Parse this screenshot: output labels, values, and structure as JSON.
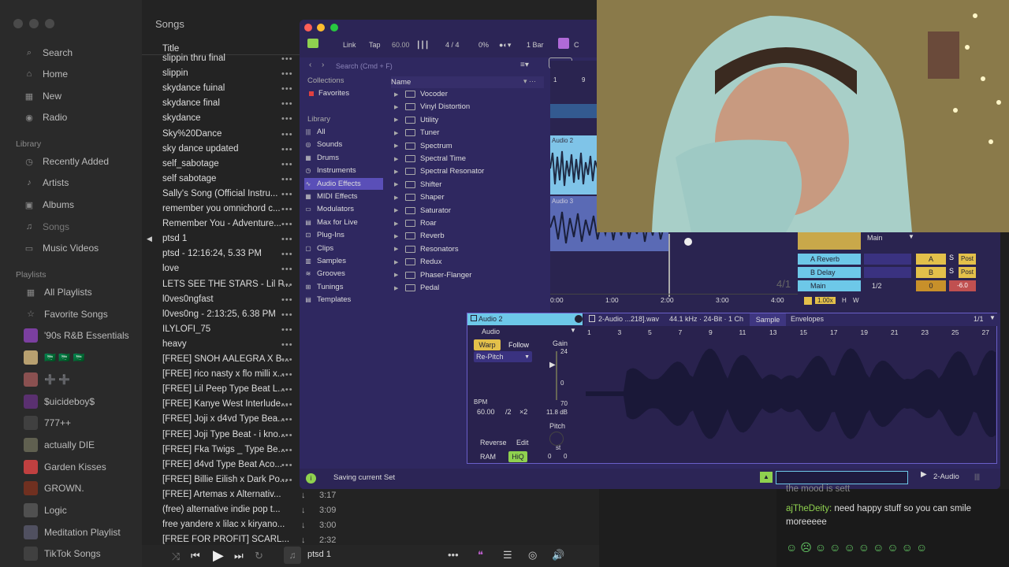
{
  "music": {
    "header_title": "Songs",
    "sidebar": {
      "items": [
        {
          "label": "Search",
          "icon": "search-icon"
        },
        {
          "label": "Home",
          "icon": "home-icon"
        },
        {
          "label": "New",
          "icon": "grid-icon"
        },
        {
          "label": "Radio",
          "icon": "radio-icon"
        }
      ],
      "library_header": "Library",
      "library": [
        {
          "label": "Recently Added",
          "icon": "clock-icon"
        },
        {
          "label": "Artists",
          "icon": "mic-icon"
        },
        {
          "label": "Albums",
          "icon": "album-icon"
        },
        {
          "label": "Songs",
          "icon": "music-note-icon"
        },
        {
          "label": "Music Videos",
          "icon": "tv-icon"
        }
      ],
      "playlists_header": "Playlists",
      "playlists": [
        {
          "label": "All Playlists",
          "icon": "grid-icon"
        },
        {
          "label": "Favorite Songs",
          "icon": "star-icon"
        },
        {
          "label": "'90s R&B Essentials",
          "color": "#7b3fa0"
        },
        {
          "label": "🇸🇦 🇸🇦 🇸🇦",
          "color": "#b8a070"
        },
        {
          "label": "➕ ➕",
          "color": "#8a5050"
        },
        {
          "label": "$uicideboy$",
          "color": "#5a3070"
        },
        {
          "label": "777++",
          "color": "#404040"
        },
        {
          "label": "actually DIE",
          "color": "#606050"
        },
        {
          "label": "Garden Kisses",
          "color": "#c04040"
        },
        {
          "label": "GROWN.",
          "color": "#703020"
        },
        {
          "label": "Logic",
          "color": "#505050"
        },
        {
          "label": "Meditation Playlist",
          "color": "#505060"
        },
        {
          "label": "TikTok Songs",
          "color": "#404040"
        }
      ]
    },
    "column_title": "Title",
    "songs": [
      {
        "title": "slippin thru final"
      },
      {
        "title": "slippin"
      },
      {
        "title": "skydance fuinal"
      },
      {
        "title": "skydance final"
      },
      {
        "title": "skydance"
      },
      {
        "title": "Sky%20Dance"
      },
      {
        "title": "sky dance updated"
      },
      {
        "title": "self_sabotage"
      },
      {
        "title": "self sabotage"
      },
      {
        "title": "Sally's Song (Official Instru..."
      },
      {
        "title": "remember you omnichord c..."
      },
      {
        "title": "Remember You - Adventure..."
      },
      {
        "title": "ptsd 1",
        "playing": true
      },
      {
        "title": "ptsd - 12:16:24, 5.33 PM"
      },
      {
        "title": "love"
      },
      {
        "title": "LETS SEE THE STARS - Lil P..."
      },
      {
        "title": "l0ves0ngfast"
      },
      {
        "title": "l0ves0ng - 2:13:25, 6.38 PM"
      },
      {
        "title": "ILYLOFI_75"
      },
      {
        "title": "heavy"
      },
      {
        "title": "[FREE] SNOH AALEGRA X B..."
      },
      {
        "title": "[FREE] rico nasty x flo milli x..."
      },
      {
        "title": "[FREE] Lil Peep Type Beat L..."
      },
      {
        "title": "[FREE] Kanye West Interlude..."
      },
      {
        "title": "[FREE] Joji x d4vd Type Bea..."
      },
      {
        "title": "[FREE] Joji Type Beat - i kno..."
      },
      {
        "title": "[FREE] Fka Twigs _ Type Be..."
      },
      {
        "title": "[FREE] d4vd Type Beat  Aco..."
      },
      {
        "title": "[FREE] Billie Eilish x Dark Po..."
      },
      {
        "title": "[FREE] Artemas x Alternativ...",
        "duration": "3:17"
      },
      {
        "title": "(free) alternative  indie pop t...",
        "duration": "3:09"
      },
      {
        "title": "free yandere x lilac x kiryano...",
        "duration": "3:00"
      },
      {
        "title": "[FREE FOR PROFIT] SCARL...",
        "duration": "2:32"
      }
    ],
    "player": {
      "now_playing": "ptsd 1"
    }
  },
  "ableton": {
    "toolbar": {
      "link": "Link",
      "tap": "Tap",
      "tempo": "60.00",
      "time_sig": "4 / 4",
      "cpu": "0%",
      "quantize": "1 Bar",
      "key": "C"
    },
    "search_placeholder": "Search (Cmd + F)",
    "collections_header": "Collections",
    "favorites": "Favorites",
    "library_header": "Library",
    "library": [
      {
        "label": "All",
        "icon": "bars-icon"
      },
      {
        "label": "Sounds",
        "icon": "sound-icon"
      },
      {
        "label": "Drums",
        "icon": "grid-icon"
      },
      {
        "label": "Instruments",
        "icon": "clock-icon"
      },
      {
        "label": "Audio Effects",
        "icon": "waveform-icon",
        "selected": true
      },
      {
        "label": "MIDI Effects",
        "icon": "grid-icon"
      },
      {
        "label": "Modulators",
        "icon": "modulator-icon"
      },
      {
        "label": "Max for Live",
        "icon": "max-icon"
      },
      {
        "label": "Plug-Ins",
        "icon": "plug-icon"
      },
      {
        "label": "Clips",
        "icon": "clip-icon"
      },
      {
        "label": "Samples",
        "icon": "sample-icon"
      },
      {
        "label": "Grooves",
        "icon": "groove-icon"
      },
      {
        "label": "Tunings",
        "icon": "tuning-icon"
      },
      {
        "label": "Templates",
        "icon": "template-icon"
      }
    ],
    "name_header": "Name",
    "effects": [
      "Vocoder",
      "Vinyl Distortion",
      "Utility",
      "Tuner",
      "Spectrum",
      "Spectral Time",
      "Spectral Resonator",
      "Shifter",
      "Shaper",
      "Saturator",
      "Roar",
      "Reverb",
      "Resonators",
      "Redux",
      "Phaser-Flanger",
      "Pedal"
    ],
    "arrangement": {
      "ruler_start": "1",
      "ruler_mark": "9",
      "tracks": [
        "Audio 2",
        "Audio 3"
      ],
      "time_labels": [
        "0:00",
        "1:00",
        "2:00",
        "3:00",
        "4:00"
      ],
      "loop_fraction": "4/1"
    },
    "mixer": {
      "main_label": "Main",
      "returns": [
        {
          "name": "A Reverb",
          "letter": "A",
          "post": "Post"
        },
        {
          "name": "B Delay",
          "letter": "B",
          "post": "Post"
        },
        {
          "name": "Main",
          "ratio": "1/2",
          "value": "0",
          "db": "-6.0"
        }
      ],
      "zoom": "1.00x",
      "h": "H",
      "w": "W"
    },
    "clip": {
      "name": "Audio 2",
      "label": "Audio",
      "file": "2-Audio ...218].wav",
      "sample_info": "44.1 kHz · 24-Bit · 1 Ch",
      "tab_sample": "Sample",
      "tab_envelopes": "Envelopes",
      "page": "1/1",
      "warp": "Warp",
      "follow": "Follow",
      "mode": "Re-Pitch",
      "gain_label": "Gain",
      "gain_top": "24",
      "gain_zero": "0",
      "gain_bottom": "70",
      "gain_db": "11.8 dB",
      "bpm_label": "BPM",
      "bpm": "60.00",
      "half": "/2",
      "double": "×2",
      "pitch_label": "Pitch",
      "st": "st",
      "reverse": "Reverse",
      "edit": "Edit",
      "ram": "RAM",
      "hiq": "HiQ",
      "pitch_a": "0",
      "pitch_b": "0",
      "ruler": [
        "1",
        "3",
        "5",
        "7",
        "9",
        "11",
        "13",
        "15",
        "17",
        "19",
        "21",
        "23",
        "25",
        "27"
      ]
    },
    "status": "Saving current Set",
    "track_name": "2-Audio"
  },
  "chat": {
    "lines": [
      {
        "user": "",
        "text": "the mood is sett"
      },
      {
        "user": "ajTheDeity:",
        "text": "need happy stuff so you can smile"
      },
      {
        "user": "",
        "text": "moreeeee"
      }
    ]
  }
}
